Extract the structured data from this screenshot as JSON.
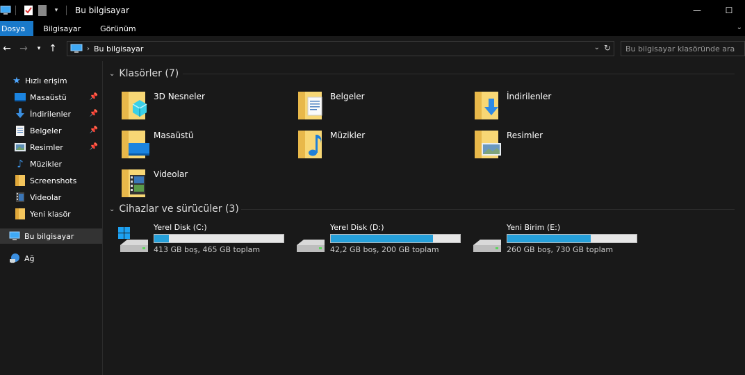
{
  "window": {
    "title": "Bu bilgisayar",
    "minimize": "—",
    "maximize": "☐"
  },
  "ribbon": {
    "tabs": [
      "Dosya",
      "Bilgisayar",
      "Görünüm"
    ]
  },
  "address": {
    "crumb": "Bu bilgisayar",
    "search_placeholder": "Bu bilgisayar klasöründe ara"
  },
  "nav": {
    "quick_access": "Hızlı erişim",
    "items": [
      {
        "label": "Masaüstü",
        "icon": "desktop-icon",
        "pinned": true
      },
      {
        "label": "İndirilenler",
        "icon": "downloads-icon",
        "pinned": true
      },
      {
        "label": "Belgeler",
        "icon": "documents-icon",
        "pinned": true
      },
      {
        "label": "Resimler",
        "icon": "pictures-icon",
        "pinned": true
      },
      {
        "label": "Müzikler",
        "icon": "music-icon",
        "pinned": false
      },
      {
        "label": "Screenshots",
        "icon": "folder-icon",
        "pinned": false
      },
      {
        "label": "Videolar",
        "icon": "videos-icon",
        "pinned": false
      },
      {
        "label": "Yeni klasör",
        "icon": "folder-icon",
        "pinned": false
      }
    ],
    "this_pc": "Bu bilgisayar",
    "network": "Ağ"
  },
  "folders_group": {
    "header": "Klasörler (7)",
    "items": [
      {
        "label": "3D Nesneler",
        "icon": "3d-objects-folder-icon"
      },
      {
        "label": "Belgeler",
        "icon": "documents-folder-icon"
      },
      {
        "label": "İndirilenler",
        "icon": "downloads-folder-icon"
      },
      {
        "label": "Masaüstü",
        "icon": "desktop-folder-icon"
      },
      {
        "label": "Müzikler",
        "icon": "music-folder-icon"
      },
      {
        "label": "Resimler",
        "icon": "pictures-folder-icon"
      },
      {
        "label": "Videolar",
        "icon": "videos-folder-icon"
      }
    ]
  },
  "drives_group": {
    "header": "Cihazlar ve sürücüler (3)",
    "items": [
      {
        "label": "Yerel Disk (C:)",
        "info": "413 GB boş, 465 GB toplam",
        "used_fraction": 0.112,
        "windows": true
      },
      {
        "label": "Yerel Disk (D:)",
        "info": "42,2 GB boş, 200 GB toplam",
        "used_fraction": 0.789,
        "windows": false
      },
      {
        "label": "Yeni Birim (E:)",
        "info": "260 GB boş, 730 GB toplam",
        "used_fraction": 0.644,
        "windows": false
      }
    ]
  },
  "colors": {
    "accent": "#1979ca",
    "bar_fill": "#26a0da",
    "folder": "#f8d775"
  }
}
